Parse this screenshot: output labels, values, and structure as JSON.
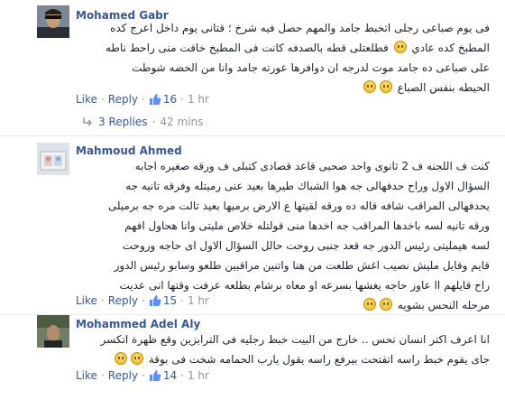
{
  "comments": [
    {
      "name": "Mohamed Gabr",
      "lines": [
        "فى يوم صباعى رجلى اتخبط جامد والمهم حصل فيه شرخ ؛ قتانى يوم داخل اعرج كده",
        "المطبخ كده عادي {e} فطلعتلى قطه بالصدفه كانت فى المطبخ خافت منى راحط ناطه",
        "على صباعى ده جامد موت لدرجه ان دوافرها عورته جامد وانا من الخضه شوطت",
        "الحيطه بنفس الصباع {e}{e}"
      ],
      "actions": {
        "like": "Like",
        "reply": "Reply",
        "likes": "16",
        "time": "1 hr"
      },
      "replies": {
        "label": "3 Replies",
        "time": "42 mins"
      }
    },
    {
      "name": "Mahmoud Ahmed",
      "lines": [
        "كنت ف اللجنه ف 2 ثانوى واحد صحبى قاعد قصادى كتبلى ف ورقه صغيره اجابه",
        "السؤال الاول وراح حدفهالى جه هوا الشباك طيرها بعيد عنى رميتله وفرقه تانيه جه",
        "يحدفهالى المراقب شافه قاله ده ورقه لقيتها ع الارض برميها بعيد تالت مره جه برميلى",
        "ورقه تانيه لسه باخدها المراقب جه اخدها منى قولتله خلاص مليتى وانا هحاول افهم",
        "لسه هيمليتى رئيس الدور جه قعد جنبى روحت حالل السؤال الاول اى حاجه وروحت",
        "قايم وقايل مليش نصيب اغش طلعت من هنا واتنين مراقبين طلعو وسابو رئيس الدور",
        "راح قايلهم اا عاوز حاجه يغشها بسرعه او معاه برشام بطلعه عرفت وقتها انى عديت",
        "مرحله النحس بشويه {e}{e}"
      ],
      "actions": {
        "like": "Like",
        "reply": "Reply",
        "likes": "15",
        "time": "1 hr"
      }
    },
    {
      "name": "Mohammed Adel Aly",
      "lines": [
        "انا اعرف اكتر انسان نحس .. خارج من البيت خبط رجليه فى الترابزين وقع ظهرة اتكسر",
        "جاى يقوم خبط راسه اتفتحت بيرفع راسه يقول يارب الحمامه شخت فى بوقة {e}{e}"
      ],
      "actions": {
        "like": "Like",
        "reply": "Reply",
        "likes": "14",
        "time": "1 hr"
      }
    }
  ]
}
